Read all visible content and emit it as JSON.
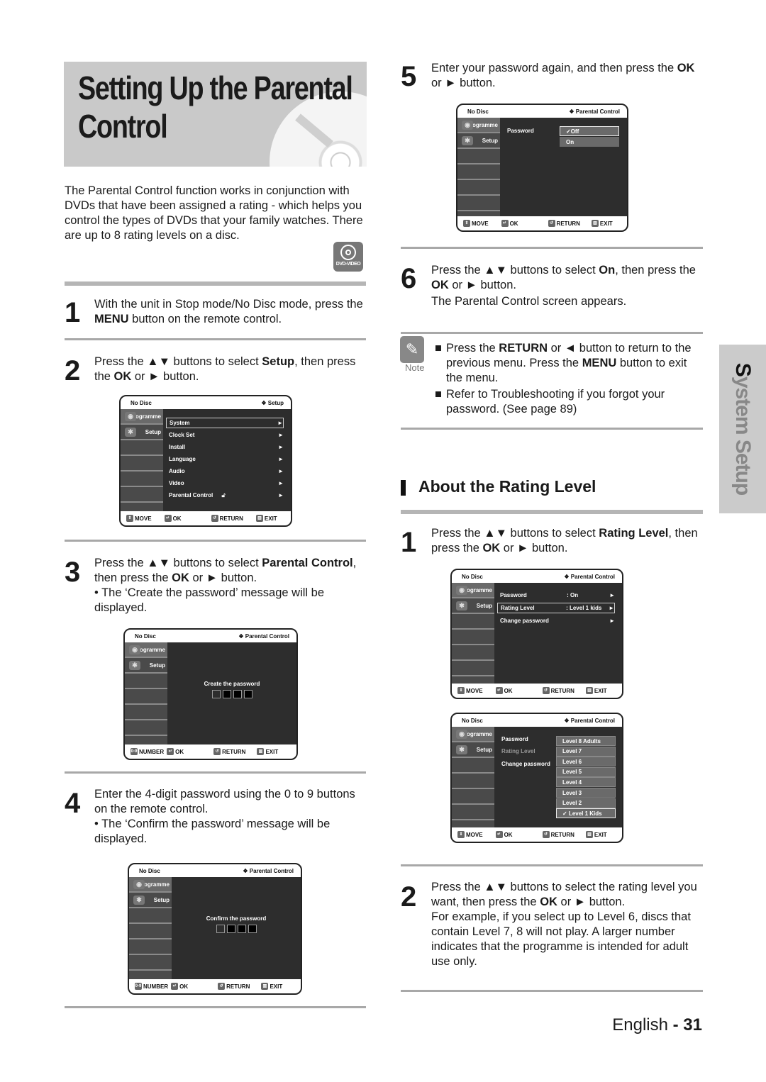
{
  "title": {
    "line1": "Setting Up the Parental",
    "line2": "Control"
  },
  "intro": "The Parental Control function works in conjunction with DVDs that have been assigned a rating - which helps you control the types of DVDs that your family watches. There are up to 8 rating levels on a disc.",
  "dvd_badge": "DVD-VIDEO",
  "side_tab": {
    "first": "S",
    "rest": "ystem Setup"
  },
  "steps_left": [
    {
      "num": "1",
      "pre": "With the unit in Stop mode/No Disc mode, press the ",
      "bold": "MENU",
      "post": " button on the remote control."
    },
    {
      "num": "2",
      "pre": "Press the ▲▼ buttons to select ",
      "bold": "Setup",
      "mid": ", then press the ",
      "bold2": "OK",
      "post": " or ► button."
    },
    {
      "num": "3",
      "pre": "Press the ▲▼ buttons to select ",
      "bold": "Parental Control",
      "mid": ", then press the ",
      "bold2": "OK",
      "post": " or ► button.",
      "bullet": "• The ‘Create the password’ message will be displayed."
    },
    {
      "num": "4",
      "text": "Enter the 4-digit password using the 0 to 9 buttons on the remote control.",
      "bullet": "• The ‘Confirm the password’ message will be displayed."
    }
  ],
  "steps_right": [
    {
      "num": "5",
      "pre": "Enter your password again, and then press the ",
      "bold": "OK",
      "post": " or ► button."
    },
    {
      "num": "6",
      "pre": "Press the ▲▼ buttons to select ",
      "bold": "On",
      "mid": ", then press the ",
      "bold2": "OK",
      "post": " or ► button.",
      "extra": "The Parental Control screen appears."
    }
  ],
  "note": {
    "label": "Note",
    "items": [
      {
        "pre": "Press the ",
        "bold": "RETURN",
        "mid": " or ◄ button to return to the previous menu. Press the ",
        "bold2": "MENU",
        "post": " button to exit the menu."
      },
      {
        "text": "Refer to Troubleshooting if you forgot your password. (See page 89)"
      }
    ]
  },
  "section": {
    "heading": "About the Rating Level",
    "steps": [
      {
        "num": "1",
        "pre": "Press the ▲▼ buttons to select ",
        "bold": "Rating Level",
        "mid": ", then press the ",
        "bold2": "OK",
        "post": " or ► button."
      },
      {
        "num": "2",
        "pre": "Press the ▲▼ buttons to select the rating level you want, then press the ",
        "bold": "OK",
        "post": " or ► button.",
        "extra": "For example, if you select up to Level 6, discs that contain Level 7, 8 will not play. A larger number indicates that the programme is intended for adult use only."
      }
    ]
  },
  "footer": {
    "lang": "English",
    "sep": " - ",
    "page": "31"
  },
  "screens": {
    "common": {
      "disc": "No Disc",
      "programme": "Programme",
      "setup": "Setup",
      "move": "MOVE",
      "number": "NUMBER",
      "ok": "OK",
      "return": "RETURN",
      "exit": "EXIT",
      "arrow": "►"
    },
    "setup_menu": {
      "header": "❖ Setup",
      "items": [
        "System",
        "Clock Set",
        "Install",
        "Language",
        "Audio",
        "Video",
        "Parental Control"
      ]
    },
    "create": {
      "header": "❖ Parental Control",
      "message": "Create the password"
    },
    "confirm": {
      "header": "❖ Parental Control",
      "message": "Confirm the password"
    },
    "password": {
      "header": "❖ Parental Control",
      "label": "Password",
      "options": [
        "✓Off",
        "On"
      ]
    },
    "parental": {
      "header": "❖ Parental Control",
      "rows": [
        {
          "label": "Password",
          "value": ": On"
        },
        {
          "label": "Rating Level",
          "value": ": Level 1 kids"
        },
        {
          "label": "Change password",
          "value": ""
        }
      ]
    },
    "rating": {
      "header": "❖ Parental Control",
      "labels": [
        "Password",
        "Rating Level",
        "Change password"
      ],
      "levels": [
        "Level 8 Adults",
        "Level 7",
        "Level 6",
        "Level 5",
        "Level 4",
        "Level 3",
        "Level 2",
        "✓ Level 1 Kids"
      ]
    }
  }
}
